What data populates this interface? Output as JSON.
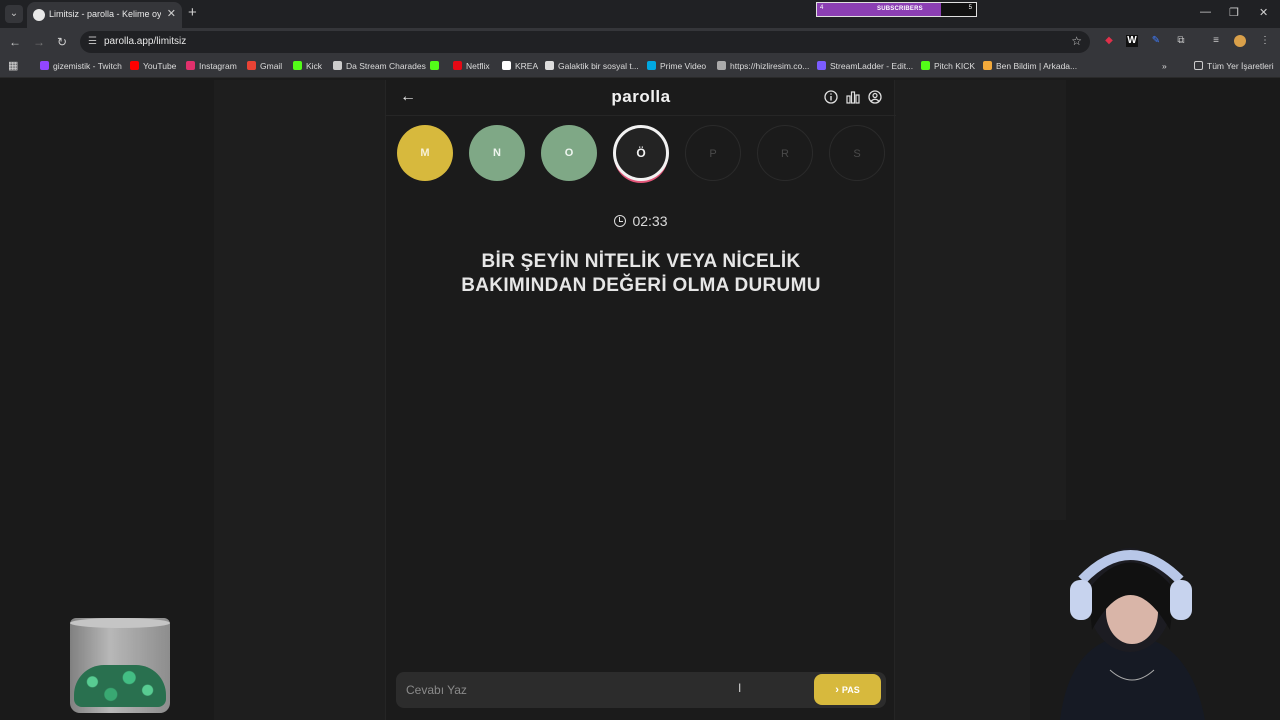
{
  "browser": {
    "tab_title": "Limitsiz - parolla - Kelime oyunu",
    "url": "parolla.app/limitsiz",
    "subscribers": {
      "label": "SUBSCRIBERS",
      "start": "4",
      "end": "5",
      "progress": 0.78
    },
    "bookmarks": [
      {
        "label": "gizemistik - Twitch",
        "color": "#9146ff"
      },
      {
        "label": "YouTube",
        "color": "#ff0000"
      },
      {
        "label": "Instagram",
        "color": "#e1306c"
      },
      {
        "label": "Gmail",
        "color": "#ea4335"
      },
      {
        "label": "Kick",
        "color": "#53fc18"
      },
      {
        "label": "Da Stream Charades",
        "color": "#cccccc"
      },
      {
        "label": "",
        "color": "#53fc18"
      },
      {
        "label": "Netflix",
        "color": "#e50914"
      },
      {
        "label": "KREA",
        "color": "#ffffff"
      },
      {
        "label": "Galaktik bir sosyal t...",
        "color": "#dddddd"
      },
      {
        "label": "Prime Video",
        "color": "#00a8e1"
      },
      {
        "label": "https://hizliresim.co...",
        "color": "#aaaaaa"
      },
      {
        "label": "StreamLadder - Edit...",
        "color": "#7b5cff"
      },
      {
        "label": "Pitch KICK",
        "color": "#53fc18"
      },
      {
        "label": "Ben Bildim | Arkada...",
        "color": "#f2a93b"
      }
    ],
    "all_bookmarks": "Tüm Yer İşaretleri"
  },
  "game": {
    "logo": "parolla",
    "letters": [
      {
        "char": "M",
        "state": "done-yellow"
      },
      {
        "char": "N",
        "state": "done-green"
      },
      {
        "char": "O",
        "state": "done-green"
      },
      {
        "char": "Ö",
        "state": "active"
      },
      {
        "char": "P",
        "state": "pending"
      },
      {
        "char": "R",
        "state": "pending"
      },
      {
        "char": "S",
        "state": "pending"
      }
    ],
    "timer": "02:33",
    "question": "BİR ŞEYİN NİTELİK VEYA NİCELİK BAKIMINDAN DEĞERİ OLMA DURUMU",
    "answer_placeholder": "Cevabı Yaz",
    "pass_label": "PAS"
  }
}
